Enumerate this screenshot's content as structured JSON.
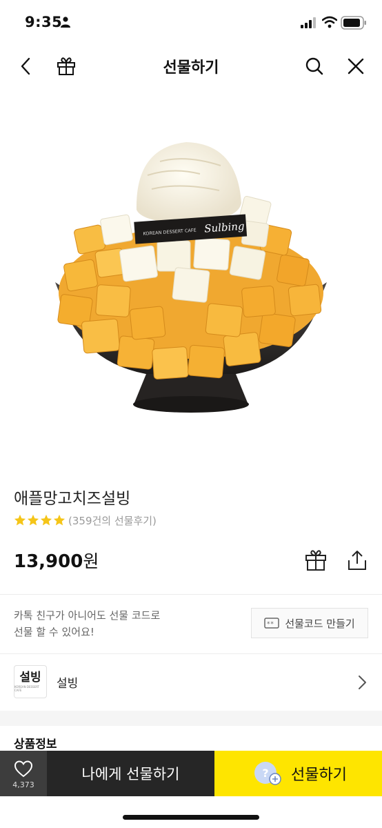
{
  "status": {
    "time": "9:35"
  },
  "header": {
    "title": "선물하기"
  },
  "product": {
    "name": "애플망고치즈설빙",
    "rating": 4,
    "review_text": "(359건의 선물후기)",
    "price": "13,900",
    "price_unit": "원",
    "image_label": "Sulbing",
    "image_sublabel": "KOREAN DESSERT CAFE"
  },
  "gift_code": {
    "notice_line1": "카톡 친구가 아니어도 선물 코드로",
    "notice_line2": "선물 할 수 있어요!",
    "button_label": "선물코드 만들기"
  },
  "brand": {
    "name": "설빙",
    "logo_text": "설빙",
    "logo_sub": "KOREAN DESSERT CAFE"
  },
  "section": {
    "title": "상품정보"
  },
  "bottom_bar": {
    "like_count": "4,373",
    "self_gift_label": "나에게 선물하기",
    "gift_label": "선물하기",
    "avatar_char": "?"
  },
  "colors": {
    "accent_yellow": "#fee500",
    "dark_button": "#262626",
    "star": "#f5c518"
  }
}
